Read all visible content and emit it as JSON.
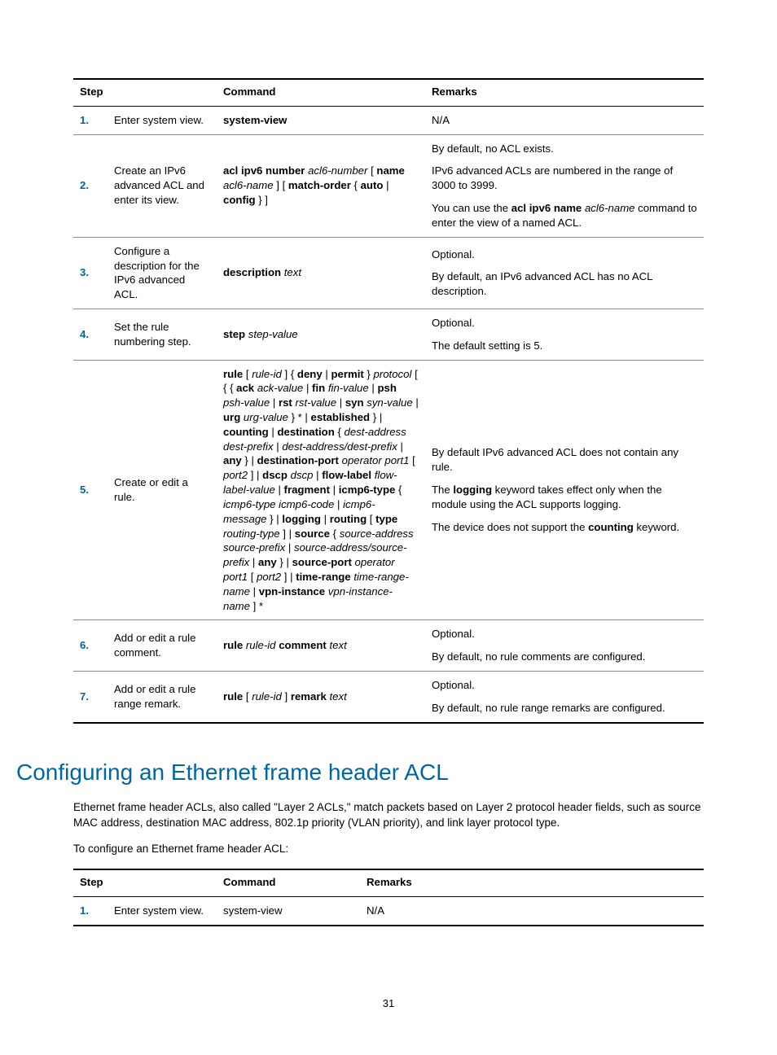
{
  "table1": {
    "headers": {
      "step": "Step",
      "command": "Command",
      "remarks": "Remarks"
    },
    "rows": [
      {
        "num": "1.",
        "desc": "Enter system view.",
        "cmd_html": "<span class='bold'>system-view</span>",
        "rem_html": "N/A"
      },
      {
        "num": "2.",
        "desc": "Create an IPv6 advanced ACL and enter its view.",
        "cmd_html": "<span class='bold'>acl ipv6 number</span> <span class='ital'>acl6-number</span> [ <span class='bold'>name</span> <span class='ital'>acl6-name</span> ] [ <span class='bold'>match-order</span> { <span class='bold'>auto</span> | <span class='bold'>config</span> } ]",
        "rem_html": "<div class='para'>By default, no ACL exists.</div><div class='para'>IPv6 advanced ACLs are numbered in the range of 3000 to 3999.</div><div>You can use the <span class='bold'>acl ipv6 name</span> <span class='ital'>acl6-name</span> command to enter the view of a named ACL.</div>"
      },
      {
        "num": "3.",
        "desc": "Configure a description for the IPv6 advanced ACL.",
        "cmd_html": "<span class='bold'>description</span> <span class='ital'>text</span>",
        "rem_html": "<div class='para'>Optional.</div><div>By default, an IPv6 advanced ACL has no ACL description.</div>"
      },
      {
        "num": "4.",
        "desc": "Set the rule numbering step.",
        "cmd_html": "<span class='bold'>step</span> <span class='ital'>step-value</span>",
        "rem_html": "<div class='para'>Optional.</div><div>The default setting is 5.</div>"
      },
      {
        "num": "5.",
        "desc": "Create or edit a rule.",
        "cmd_html": "<span class='bold'>rule</span> [ <span class='ital'>rule-id</span> ] { <span class='bold'>deny</span> | <span class='bold'>permit</span> } <span class='ital'>protocol</span> [ { { <span class='bold'>ack</span> <span class='ital'>ack-value</span> | <span class='bold'>fin</span> <span class='ital'>fin-value</span> | <span class='bold'>psh</span> <span class='ital'>psh-value</span> | <span class='bold'>rst</span> <span class='ital'>rst-value</span> | <span class='bold'>syn</span> <span class='ital'>syn-value</span> | <span class='bold'>urg</span> <span class='ital'>urg-value</span> } * | <span class='bold'>established</span> } | <span class='bold'>counting</span> | <span class='bold'>destination</span> { <span class='ital'>dest-address dest-prefix</span> | <span class='ital'>dest-address/dest-prefix</span> | <span class='bold'>any</span> } | <span class='bold'>destination-port</span> <span class='ital'>operator port1</span> [ <span class='ital'>port2</span> ] | <span class='bold'>dscp</span> <span class='ital'>dscp</span> | <span class='bold'>flow-label</span> <span class='ital'>flow-label-value</span> | <span class='bold'>fragment</span> | <span class='bold'>icmp6-type</span> { <span class='ital'>icmp6-type icmp6-code</span> | <span class='ital'>icmp6-message</span> } | <span class='bold'>logging</span> | <span class='bold'>routing</span> [ <span class='bold'>type</span> <span class='ital'>routing-type</span> ] | <span class='bold'>source</span> { <span class='ital'>source-address source-prefix</span> | <span class='ital'>source-address/source-prefix</span> | <span class='bold'>any</span> } | <span class='bold'>source-port</span> <span class='ital'>operator port1</span> [ <span class='ital'>port2</span> ] | <span class='bold'>time-range</span> <span class='ital'>time-range-name</span> | <span class='bold'>vpn-instance</span> <span class='ital'>vpn-instance-name</span> ] *",
        "rem_html": "<div class='para'>By default IPv6 advanced ACL does not contain any rule.</div><div class='para'>The <span class='bold'>logging</span> keyword takes effect only when the module using the ACL supports logging.</div><div>The device does not support the <span class='bold'>counting</span> keyword.</div>"
      },
      {
        "num": "6.",
        "desc": "Add or edit a rule comment.",
        "cmd_html": "<span class='bold'>rule</span> <span class='ital'>rule-id</span> <span class='bold'>comment</span> <span class='ital'>text</span>",
        "rem_html": "<div class='para'>Optional.</div><div>By default, no rule comments are configured.</div>"
      },
      {
        "num": "7.",
        "desc": "Add or edit a rule range remark.",
        "cmd_html": "<span class='bold'>rule</span> [ <span class='ital'>rule-id</span> ] <span class='bold'>remark</span> <span class='ital'>text</span>",
        "rem_html": "<div class='para'>Optional.</div><div>By default, no rule range remarks are configured.</div>"
      }
    ]
  },
  "section_heading": "Configuring an Ethernet frame header ACL",
  "section_para": "Ethernet frame header ACLs, also called \"Layer 2 ACLs,\" match packets based on Layer 2 protocol header fields, such as source MAC address, destination MAC address, 802.1p priority (VLAN priority), and link layer protocol type.",
  "section_lead": "To configure an Ethernet frame header ACL:",
  "table2": {
    "headers": {
      "step": "Step",
      "command": "Command",
      "remarks": "Remarks"
    },
    "rows": [
      {
        "num": "1.",
        "desc": "Enter system view.",
        "cmd_html": "system-view",
        "rem_html": "N/A"
      }
    ]
  },
  "page_number": "31"
}
